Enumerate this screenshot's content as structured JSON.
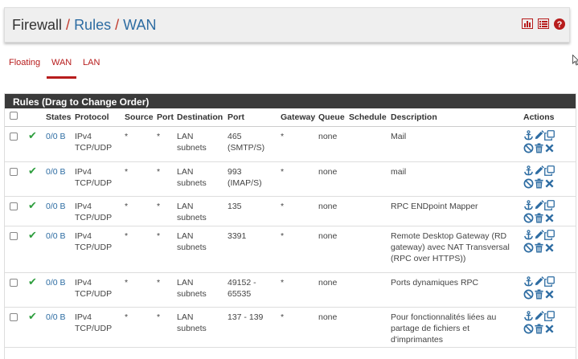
{
  "breadcrumb": {
    "root": "Firewall",
    "sep1": "/",
    "item2": "Rules",
    "sep2": "/",
    "item3": "WAN"
  },
  "header_icons": [
    "bar-chart-icon",
    "list-icon",
    "help-icon"
  ],
  "tabs": [
    {
      "label": "Floating",
      "active": false
    },
    {
      "label": "WAN",
      "active": true
    },
    {
      "label": "LAN",
      "active": false
    }
  ],
  "panel": {
    "title": "Rules (Drag to Change Order)"
  },
  "columns": [
    "States",
    "Protocol",
    "Source",
    "Port",
    "Destination",
    "Port",
    "Gateway",
    "Queue",
    "Schedule",
    "Description",
    "Actions"
  ],
  "rows": [
    {
      "states": "0/0 B",
      "protocol": [
        "IPv4",
        "TCP/UDP"
      ],
      "source": "*",
      "src_port": "*",
      "destination": [
        "LAN",
        "subnets"
      ],
      "dst_port": [
        "465",
        "(SMTP/S)"
      ],
      "gateway": "*",
      "queue": "none",
      "schedule": "",
      "description": [
        "Mail"
      ]
    },
    {
      "states": "0/0 B",
      "protocol": [
        "IPv4",
        "TCP/UDP"
      ],
      "source": "*",
      "src_port": "*",
      "destination": [
        "LAN",
        "subnets"
      ],
      "dst_port": [
        "993",
        "(IMAP/S)"
      ],
      "gateway": "*",
      "queue": "none",
      "schedule": "",
      "description": [
        "mail"
      ]
    },
    {
      "states": "0/0 B",
      "protocol": [
        "IPv4",
        "TCP/UDP"
      ],
      "source": "*",
      "src_port": "*",
      "destination": [
        "LAN",
        "subnets"
      ],
      "dst_port": [
        "135"
      ],
      "gateway": "*",
      "queue": "none",
      "schedule": "",
      "description": [
        "RPC ENDpoint Mapper"
      ]
    },
    {
      "states": "0/0 B",
      "protocol": [
        "IPv4",
        "TCP/UDP"
      ],
      "source": "*",
      "src_port": "*",
      "destination": [
        "LAN",
        "subnets"
      ],
      "dst_port": [
        "3391"
      ],
      "gateway": "*",
      "queue": "none",
      "schedule": "",
      "description": [
        "Remote Desktop Gateway (RD",
        "gateway) avec NAT Transversal",
        "(RPC over HTTPS))"
      ]
    },
    {
      "states": "0/0 B",
      "protocol": [
        "IPv4",
        "TCP/UDP"
      ],
      "source": "*",
      "src_port": "*",
      "destination": [
        "LAN",
        "subnets"
      ],
      "dst_port": [
        "49152 -",
        "65535"
      ],
      "gateway": "*",
      "queue": "none",
      "schedule": "",
      "description": [
        "Ports dynamiques RPC"
      ]
    },
    {
      "states": "0/0 B",
      "protocol": [
        "IPv4",
        "TCP/UDP"
      ],
      "source": "*",
      "src_port": "*",
      "destination": [
        "LAN",
        "subnets"
      ],
      "dst_port": [
        "137 - 139"
      ],
      "gateway": "*",
      "queue": "none",
      "schedule": "",
      "description": [
        "Pour fonctionnalités liées au",
        "partage de fichiers et",
        "d'imprimantes"
      ]
    }
  ],
  "row_action_icons": [
    "anchor-icon",
    "edit-pencil-icon",
    "copy-icon",
    "disable-icon",
    "trash-icon",
    "delete-x-icon"
  ],
  "colors": {
    "accent_red": "#b71c1c",
    "link_blue": "#2d6ca2",
    "panel_header": "#3a3a3a",
    "status_green": "#2e9e3e"
  }
}
